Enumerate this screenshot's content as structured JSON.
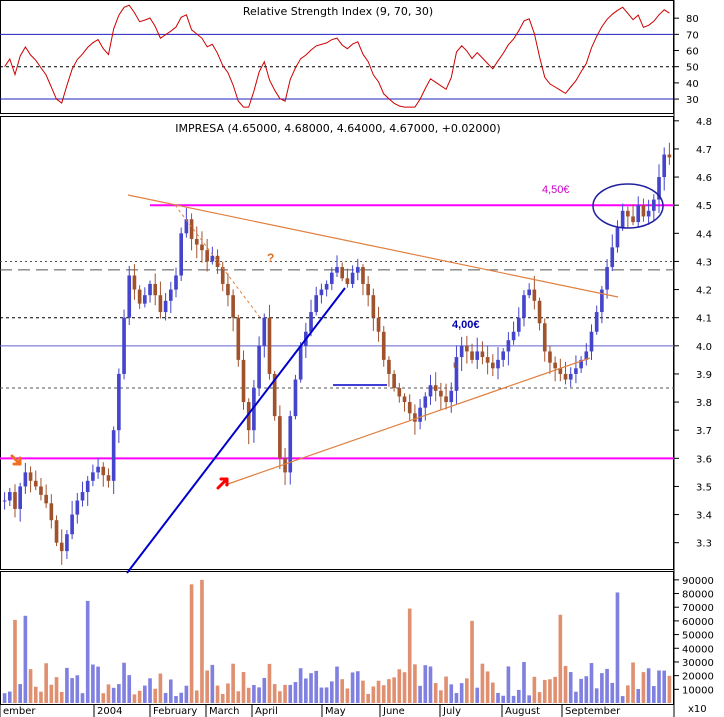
{
  "chart_data": {
    "type": "candlestick",
    "title": "IMPRESA (4.65000, 4.68000, 4.64000, 4.67000, +0.02000)",
    "indicator_title": "Relative Strength Index (9, 70, 30)",
    "volume_multiplier": "x10",
    "months": [
      "ember",
      "2004",
      "February",
      "March",
      "April",
      "May",
      "June",
      "July",
      "August",
      "September"
    ],
    "price_axis": {
      "ticks": [
        "4.8",
        "4.7",
        "4.6",
        "4.5",
        "4.4",
        "4.3",
        "4.2",
        "4.1",
        "4.0",
        "3.9",
        "3.8",
        "3.7",
        "3.6",
        "3.5",
        "3.4",
        "3.3"
      ],
      "range": [
        3.21,
        4.81
      ]
    },
    "rsi_axis": {
      "ticks": [
        "80",
        "70",
        "60",
        "50",
        "40",
        "30"
      ],
      "range": [
        22,
        90
      ],
      "upper": 70,
      "lower": 30,
      "mid": 50
    },
    "volume_axis": {
      "ticks": [
        "90000",
        "80000",
        "70000",
        "60000",
        "50000",
        "40000",
        "30000",
        "20000",
        "10000"
      ],
      "range": [
        0,
        95000
      ]
    },
    "annotations": {
      "resistance_label": "4,50€",
      "support_label": "4,00€",
      "question_mark": "?",
      "u_mark": "u"
    },
    "levels": {
      "resistance": 4.5,
      "support_high": 4.0,
      "support_low": 3.6,
      "dashed": 4.27
    },
    "colors": {
      "up": "#4444cc",
      "down": "#a0522d",
      "rsi": "#cc0000",
      "magenta": "#ff00ff",
      "trend": "#e08040",
      "blue_trend": "#0000cc",
      "vol_up": "#8080e0",
      "vol_down": "#e09070"
    },
    "series": [
      {
        "name": "Close",
        "values": [
          3.45,
          3.48,
          3.42,
          3.5,
          3.55,
          3.52,
          3.5,
          3.47,
          3.44,
          3.38,
          3.3,
          3.27,
          3.33,
          3.4,
          3.45,
          3.48,
          3.52,
          3.55,
          3.57,
          3.54,
          3.52,
          3.7,
          3.9,
          4.1,
          4.25,
          4.2,
          4.15,
          4.18,
          4.22,
          4.18,
          4.12,
          4.16,
          4.2,
          4.25,
          4.4,
          4.45,
          4.38,
          4.36,
          4.34,
          4.3,
          4.32,
          4.28,
          4.22,
          4.18,
          4.1,
          3.95,
          3.8,
          3.7,
          3.85,
          4.0,
          4.1,
          3.9,
          3.75,
          3.6,
          3.55,
          3.75,
          3.88,
          4.0,
          4.05,
          4.12,
          4.18,
          4.2,
          4.22,
          4.26,
          4.28,
          4.24,
          4.22,
          4.26,
          4.28,
          4.22,
          4.18,
          4.1,
          4.05,
          3.95,
          3.9,
          3.85,
          3.82,
          3.8,
          3.76,
          3.73,
          3.78,
          3.82,
          3.86,
          3.84,
          3.82,
          3.8,
          3.84,
          3.96,
          4.0,
          3.98,
          3.95,
          3.98,
          3.96,
          3.94,
          3.92,
          3.95,
          3.98,
          4.02,
          4.05,
          4.1,
          4.18,
          4.2,
          4.16,
          4.08,
          3.98,
          3.94,
          3.92,
          3.9,
          3.88,
          3.9,
          3.92,
          3.95,
          3.98,
          4.05,
          4.12,
          4.2,
          4.28,
          4.35,
          4.42,
          4.48,
          4.46,
          4.44,
          4.5,
          4.46,
          4.48,
          4.52,
          4.6,
          4.68,
          4.67
        ]
      }
    ]
  }
}
